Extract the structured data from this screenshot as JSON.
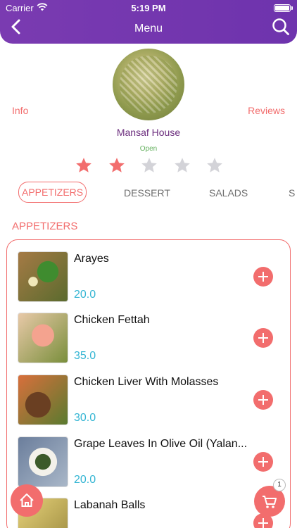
{
  "status_bar": {
    "carrier": "Carrier",
    "time": "5:19 PM"
  },
  "header": {
    "title": "Menu"
  },
  "restaurant": {
    "name": "Mansaf House",
    "status": "Open",
    "info_label": "Info",
    "reviews_label": "Reviews",
    "rating": 2,
    "rating_max": 5
  },
  "tabs": [
    {
      "label": "APPETIZERS",
      "active": true
    },
    {
      "label": "DESSERT",
      "active": false
    },
    {
      "label": "SALADS",
      "active": false
    },
    {
      "label": "S",
      "active": false
    }
  ],
  "section_title": "APPETIZERS",
  "items": [
    {
      "name": "Arayes",
      "price": "20.0"
    },
    {
      "name": "Chicken Fettah",
      "price": "35.0"
    },
    {
      "name": "Chicken Liver With Molasses",
      "price": "30.0"
    },
    {
      "name": "Grape Leaves In Olive Oil (Yalan...",
      "price": "20.0"
    },
    {
      "name": "Labanah Balls",
      "price": ""
    }
  ],
  "cart": {
    "count": "1"
  },
  "colors": {
    "brand": "#7a3bb1",
    "accent": "#f26d6d",
    "price": "#34b5d3",
    "open": "#64b15e",
    "name": "#6b2d7d"
  },
  "icons": {
    "back": "chevron-left-icon",
    "search": "search-icon",
    "home": "home-icon",
    "cart": "cart-icon",
    "star": "star-icon",
    "add": "plus-icon"
  }
}
